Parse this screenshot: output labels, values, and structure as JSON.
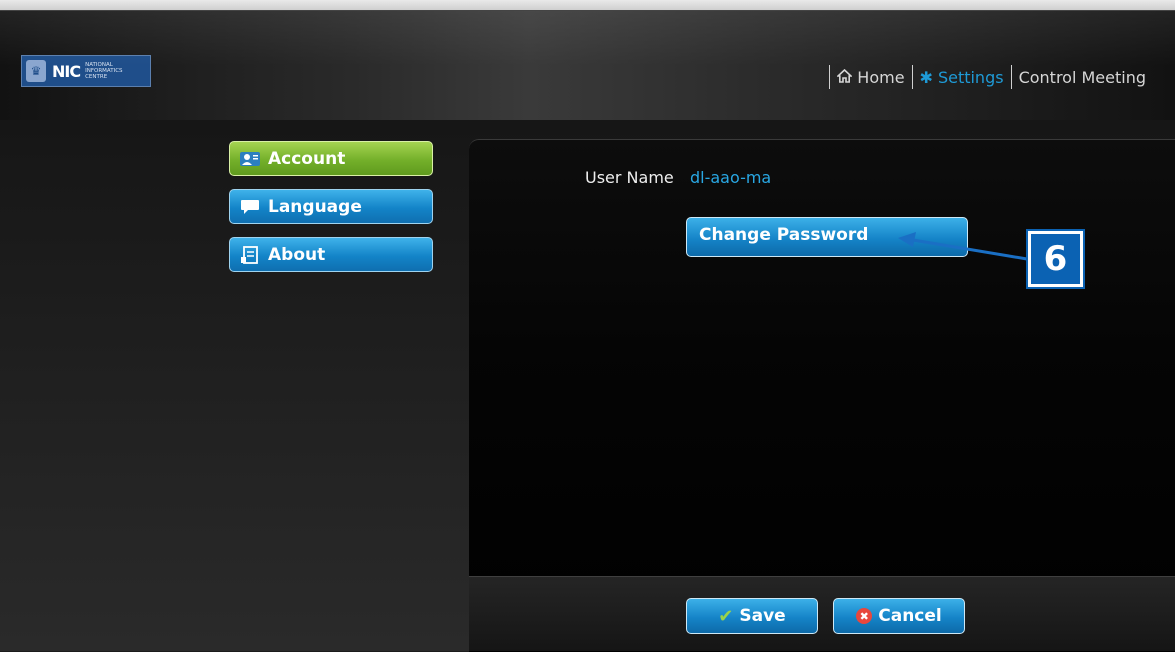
{
  "brand": {
    "logo_mark": "NIC",
    "logo_text": "NATIONAL INFORMATICS CENTRE"
  },
  "nav": {
    "items": [
      {
        "label": "Home",
        "icon": "home-icon"
      },
      {
        "label": "Settings",
        "icon": "gear-icon",
        "active": true
      },
      {
        "label": "Control Meeting"
      }
    ]
  },
  "sidebar": {
    "items": [
      {
        "label": "Account",
        "icon": "account-icon",
        "active": true
      },
      {
        "label": "Language",
        "icon": "speech-bubble-icon"
      },
      {
        "label": "About",
        "icon": "document-icon"
      }
    ]
  },
  "account": {
    "user_name_label": "User Name",
    "user_name_value": "dl-aao-ma",
    "change_password_label": "Change Password"
  },
  "footer": {
    "save_label": "Save",
    "cancel_label": "Cancel"
  },
  "callout": {
    "number": "6"
  },
  "colors": {
    "accent_blue": "#1e9ad6",
    "active_green": "#74b02a",
    "callout_blue": "#0b62b3"
  }
}
